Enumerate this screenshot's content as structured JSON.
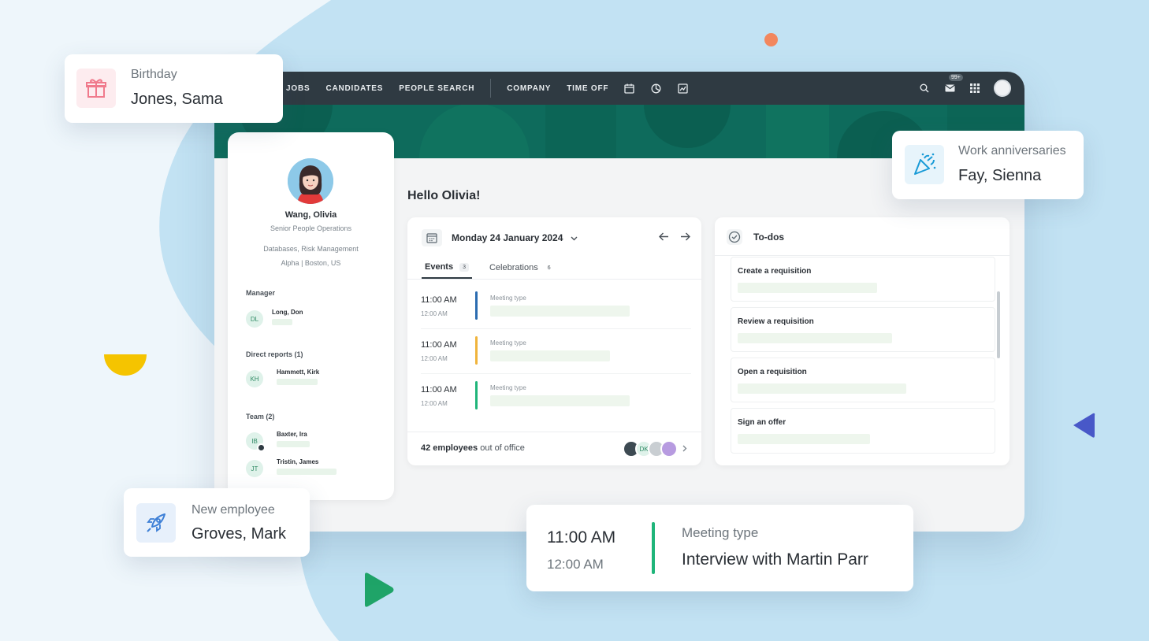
{
  "nav": {
    "items": [
      "JOBS",
      "CANDIDATES",
      "PEOPLE SEARCH",
      "COMPANY",
      "TIME OFF"
    ],
    "badge": "99+"
  },
  "profile": {
    "name": "Wang, Olivia",
    "title": "Senior People Operations",
    "departments": "Databases, Risk Management",
    "location": "Alpha | Boston, US",
    "manager_label": "Manager",
    "manager": {
      "initials": "DL",
      "name": "Long, Don"
    },
    "reports_label": "Direct reports (1)",
    "reports": [
      {
        "initials": "KH",
        "name": "Hammett, Kirk"
      }
    ],
    "team_label": "Team (2)",
    "team": [
      {
        "initials": "IB",
        "name": "Baxter, Ira"
      },
      {
        "initials": "JT",
        "name": "Tristin, James"
      }
    ]
  },
  "greeting": "Hello Olivia!",
  "events": {
    "date": "Monday 24 January 2024",
    "tabs": [
      {
        "label": "Events",
        "count": "3"
      },
      {
        "label": "Celebrations",
        "count": "6"
      }
    ],
    "items": [
      {
        "start": "11:00 AM",
        "end": "12:00 AM",
        "type": "Meeting type",
        "color": "#2b6cb0"
      },
      {
        "start": "11:00 AM",
        "end": "12:00 AM",
        "type": "Meeting type",
        "color": "#f0b43c"
      },
      {
        "start": "11:00 AM",
        "end": "12:00 AM",
        "type": "Meeting type",
        "color": "#1fb57a"
      }
    ],
    "out_of_office_count": "42 employees",
    "out_of_office_rest": "out of office",
    "face_initials": "DK"
  },
  "todos": {
    "title": "To-dos",
    "items": [
      "Create a requisition",
      "Review a requisition",
      "Open a requisition",
      "Sign an offer"
    ]
  },
  "cards": {
    "birthday": {
      "label": "Birthday",
      "name": "Jones, Sama"
    },
    "anniversary": {
      "label": "Work anniversaries",
      "name": "Fay, Sienna"
    },
    "new_employee": {
      "label": "New employee",
      "name": "Groves, Mark"
    },
    "meeting": {
      "start": "11:00 AM",
      "end": "12:00 AM",
      "type": "Meeting type",
      "title": "Interview with Martin Parr"
    }
  },
  "colors": {
    "topbar": "#2f3a42",
    "banner": "#0e6b5c",
    "accent_green": "#1fb57a",
    "accent_orange": "#f0b43c",
    "accent_blue": "#2b6cb0"
  }
}
